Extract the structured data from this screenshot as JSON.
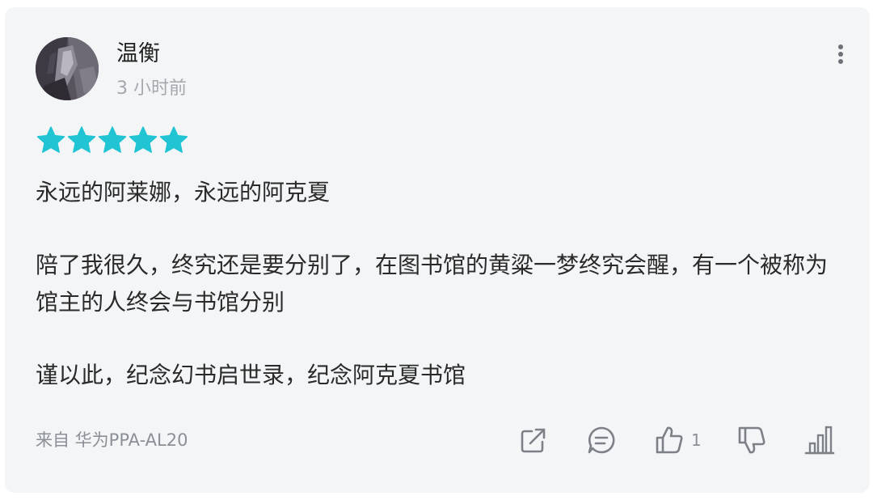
{
  "comment": {
    "author": {
      "name": "温衡",
      "avatar_icon": "user-avatar"
    },
    "time": "3 小时前",
    "rating": {
      "stars": 5,
      "max": 5,
      "color": "#20c4d2"
    },
    "paragraphs": [
      "永远的阿莱娜，永远的阿克夏",
      "陪了我很久，终究还是要分别了，在图书馆的黄粱一梦终究会醒，有一个被称为馆主的人终会与书馆分别",
      "谨以此，纪念幻书启世录，纪念阿克夏书馆"
    ],
    "device": "来自 华为PPA-AL20",
    "actions": {
      "share_icon": "share-icon",
      "reply_icon": "comment-icon",
      "like_icon": "thumbs-up-icon",
      "like_count": "1",
      "dislike_icon": "thumbs-down-icon",
      "stats_icon": "bar-chart-icon"
    },
    "menu_icon": "more-vertical-icon"
  },
  "colors": {
    "card_bg": "#f4f5f7",
    "icon_gray": "#7c8087",
    "star": "#20c4d2"
  }
}
